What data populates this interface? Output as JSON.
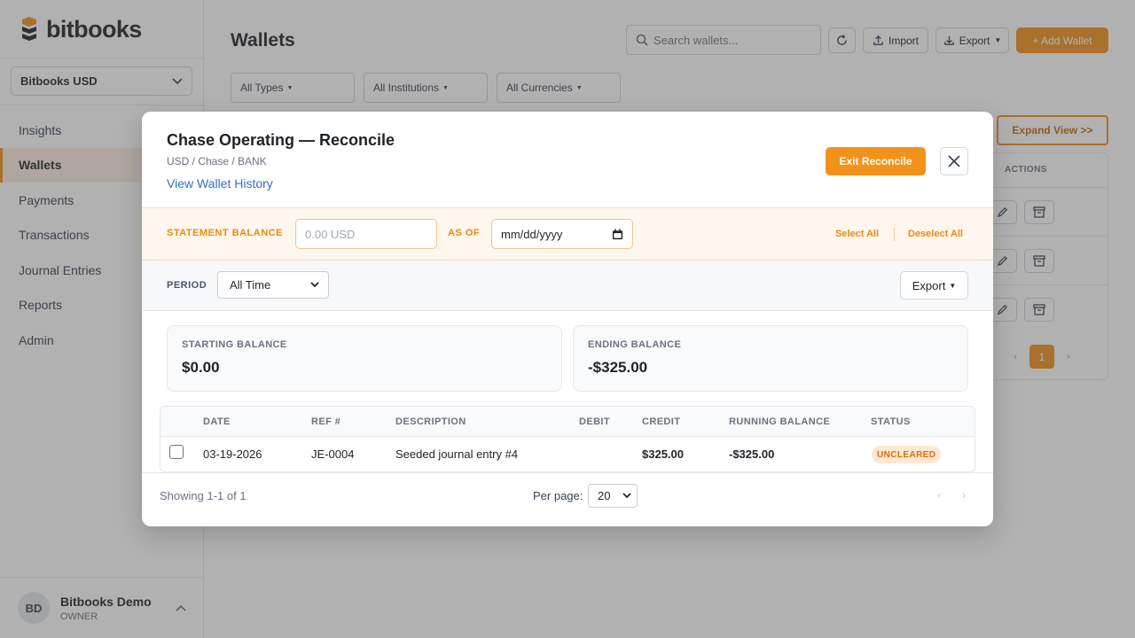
{
  "app": {
    "logo_text": "bitbooks",
    "brand_color": "#f2921a"
  },
  "sidebar": {
    "org_selector": "Bitbooks USD",
    "items": [
      {
        "label": "Insights"
      },
      {
        "label": "Wallets",
        "active": true
      },
      {
        "label": "Payments"
      },
      {
        "label": "Transactions"
      },
      {
        "label": "Journal Entries"
      },
      {
        "label": "Reports"
      },
      {
        "label": "Admin"
      }
    ],
    "user": {
      "initials": "BD",
      "name": "Bitbooks Demo",
      "role": "OWNER"
    }
  },
  "page": {
    "title": "Wallets",
    "search_placeholder": "Search wallets...",
    "import_label": "Import",
    "export_label": "Export",
    "add_label": "+ Add Wallet",
    "filters": [
      "All Types",
      "All Institutions",
      "All Currencies"
    ],
    "expand_label": "Expand View >>",
    "actions_header": "ACTIONS",
    "current_page": "1"
  },
  "modal": {
    "title": "Chase Operating — Reconcile",
    "subtitle": "USD / Chase / BANK",
    "history_link": "View Wallet History",
    "exit_label": "Exit Reconcile",
    "statement_balance_label": "STATEMENT BALANCE",
    "statement_balance_placeholder": "0.00 USD",
    "as_of_label": "AS OF",
    "date_placeholder": "mm/dd/yyyy",
    "select_all": "Select All",
    "deselect_all": "Deselect All",
    "period_label": "PERIOD",
    "period_value": "All Time",
    "export_label": "Export",
    "starting_balance_label": "STARTING BALANCE",
    "starting_balance": "$0.00",
    "ending_balance_label": "ENDING BALANCE",
    "ending_balance": "-$325.00",
    "table": {
      "headers": [
        "DATE",
        "REF #",
        "DESCRIPTION",
        "DEBIT",
        "CREDIT",
        "RUNNING BALANCE",
        "STATUS"
      ],
      "rows": [
        {
          "date": "03-19-2026",
          "ref": "JE-0004",
          "description": "Seeded journal entry #4",
          "debit": "",
          "credit": "$325.00",
          "running_balance": "-$325.00",
          "status": "UNCLEARED"
        }
      ]
    },
    "footer": {
      "showing": "Showing 1-1 of 1",
      "per_page_label": "Per page:",
      "per_page_value": "20"
    }
  }
}
